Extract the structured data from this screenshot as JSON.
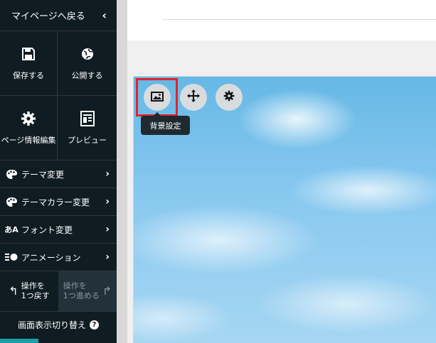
{
  "sidebar": {
    "back_label": "マイページへ戻る",
    "grid": [
      {
        "label": "保存する",
        "icon": "save-icon"
      },
      {
        "label": "公開する",
        "icon": "globe-icon"
      },
      {
        "label": "ページ情報編集",
        "icon": "gear-icon"
      },
      {
        "label": "プレビュー",
        "icon": "preview-icon"
      }
    ],
    "menu": [
      {
        "label": "テーマ変更",
        "icon": "palette-icon"
      },
      {
        "label": "テーマカラー変更",
        "icon": "palette-icon"
      },
      {
        "label": "フォント変更",
        "icon": "font-icon"
      },
      {
        "label": "アニメーション",
        "icon": "animation-icon"
      }
    ],
    "undo": {
      "line1": "操作を",
      "line2": "1つ戻す"
    },
    "redo": {
      "line1": "操作を",
      "line2": "1つ進める"
    },
    "display_toggle": "画面表示切り替え"
  },
  "toolbar": {
    "tooltip": "背景設定",
    "buttons": [
      "image-icon",
      "move-icon",
      "gear-icon"
    ]
  },
  "colors": {
    "sidebar_bg": "#0f1d22",
    "highlight": "#e0242a",
    "accent": "#1aa0a8"
  }
}
